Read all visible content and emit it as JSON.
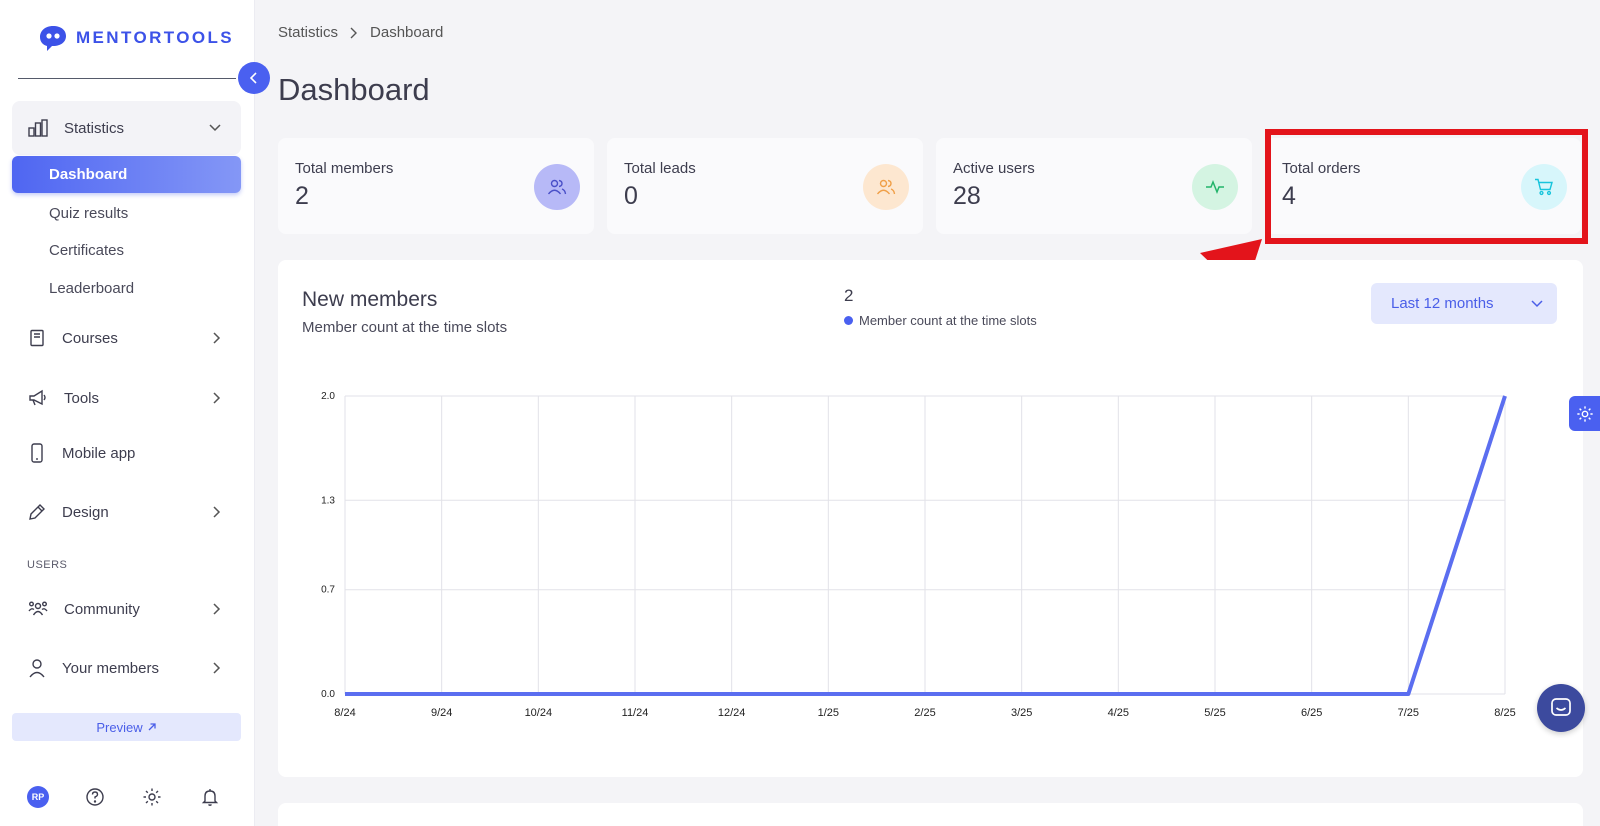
{
  "app": {
    "logo_text": "MENTORTOOLS"
  },
  "sidebar": {
    "statistics": "Statistics",
    "sub_items": [
      "Dashboard",
      "Quiz results",
      "Certificates",
      "Leaderboard"
    ],
    "courses": "Courses",
    "tools": "Tools",
    "mobile_app": "Mobile app",
    "design": "Design",
    "users_section": "USERS",
    "community": "Community",
    "your_members": "Your members",
    "preview": "Preview",
    "avatar_initials": "RP"
  },
  "breadcrumb": {
    "parent": "Statistics",
    "current": "Dashboard"
  },
  "page": {
    "title": "Dashboard"
  },
  "cards": [
    {
      "label": "Total members",
      "value": "2",
      "icon": "users-icon",
      "color": "#b7b9f7"
    },
    {
      "label": "Total leads",
      "value": "0",
      "icon": "users-icon",
      "color": "#fde7d0"
    },
    {
      "label": "Active users",
      "value": "28",
      "icon": "activity-icon",
      "color": "#d4f4e2"
    },
    {
      "label": "Total orders",
      "value": "4",
      "icon": "cart-icon",
      "color": "#d7f6fb"
    }
  ],
  "chart_section": {
    "title": "New members",
    "subtitle": "Member count at the time slots",
    "legend_value": "2",
    "legend_label": "Member count at the time slots",
    "range": "Last 12 months"
  },
  "chart_data": {
    "type": "line",
    "categories": [
      "8/24",
      "9/24",
      "10/24",
      "11/24",
      "12/24",
      "1/25",
      "2/25",
      "3/25",
      "4/25",
      "5/25",
      "6/25",
      "7/25",
      "8/25"
    ],
    "series": [
      {
        "name": "Member count at the time slots",
        "values": [
          0,
          0,
          0,
          0,
          0,
          0,
          0,
          0,
          0,
          0,
          0,
          0,
          2
        ]
      }
    ],
    "yticks": [
      "0.0",
      "0.7",
      "1.3",
      "2.0"
    ],
    "ylim": [
      0,
      2
    ],
    "grid": true,
    "color": "#5b6ef0"
  },
  "colors": {
    "accent": "#4a60f0",
    "highlight": "#e3141b"
  }
}
